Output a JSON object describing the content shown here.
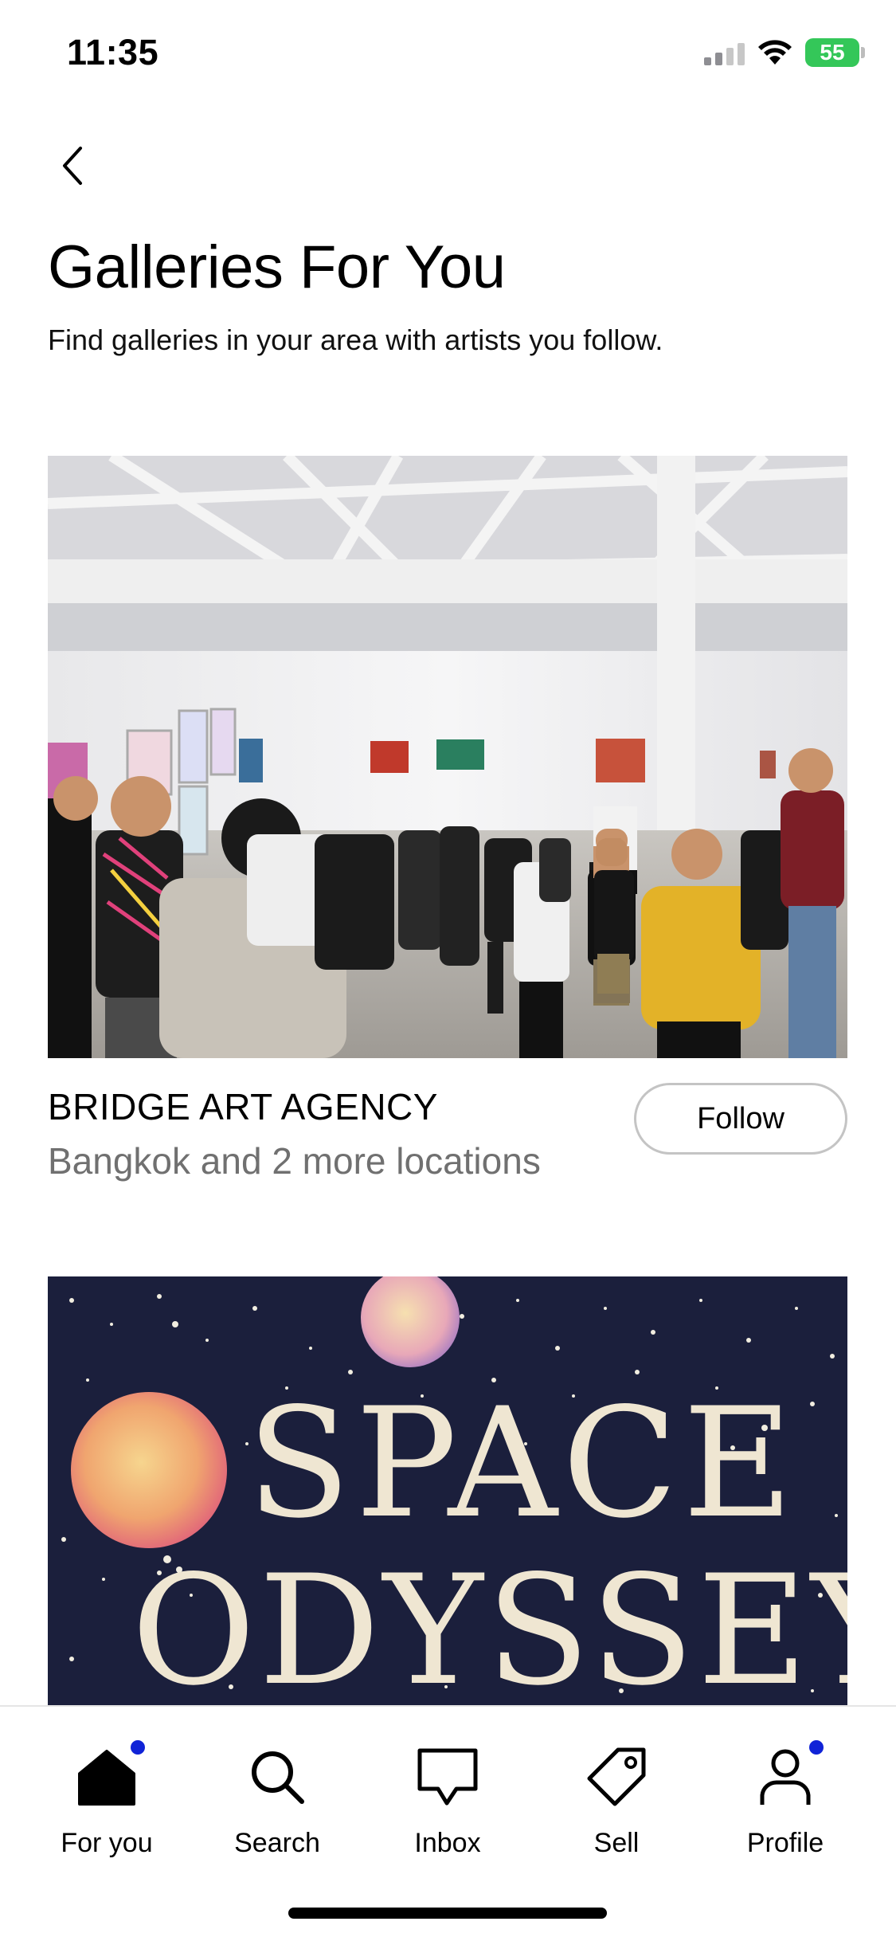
{
  "status_bar": {
    "time": "11:35",
    "battery": "55"
  },
  "header": {
    "title": "Galleries For You",
    "subtitle": "Find galleries in your area with artists you follow."
  },
  "galleries": [
    {
      "name": "BRIDGE ART AGENCY",
      "location": "Bangkok and 2 more locations",
      "follow_label": "Follow"
    },
    {
      "artwork_text_line1": "SPACE",
      "artwork_text_line2": "ODYSSEY"
    }
  ],
  "tabs": [
    {
      "label": "For you",
      "icon": "home-icon",
      "badge": true
    },
    {
      "label": "Search",
      "icon": "search-icon",
      "badge": false
    },
    {
      "label": "Inbox",
      "icon": "inbox-icon",
      "badge": false
    },
    {
      "label": "Sell",
      "icon": "tag-icon",
      "badge": false
    },
    {
      "label": "Profile",
      "icon": "profile-icon",
      "badge": true
    }
  ],
  "colors": {
    "badge": "#1023d7",
    "battery": "#34c759",
    "secondary_text": "#707070"
  }
}
